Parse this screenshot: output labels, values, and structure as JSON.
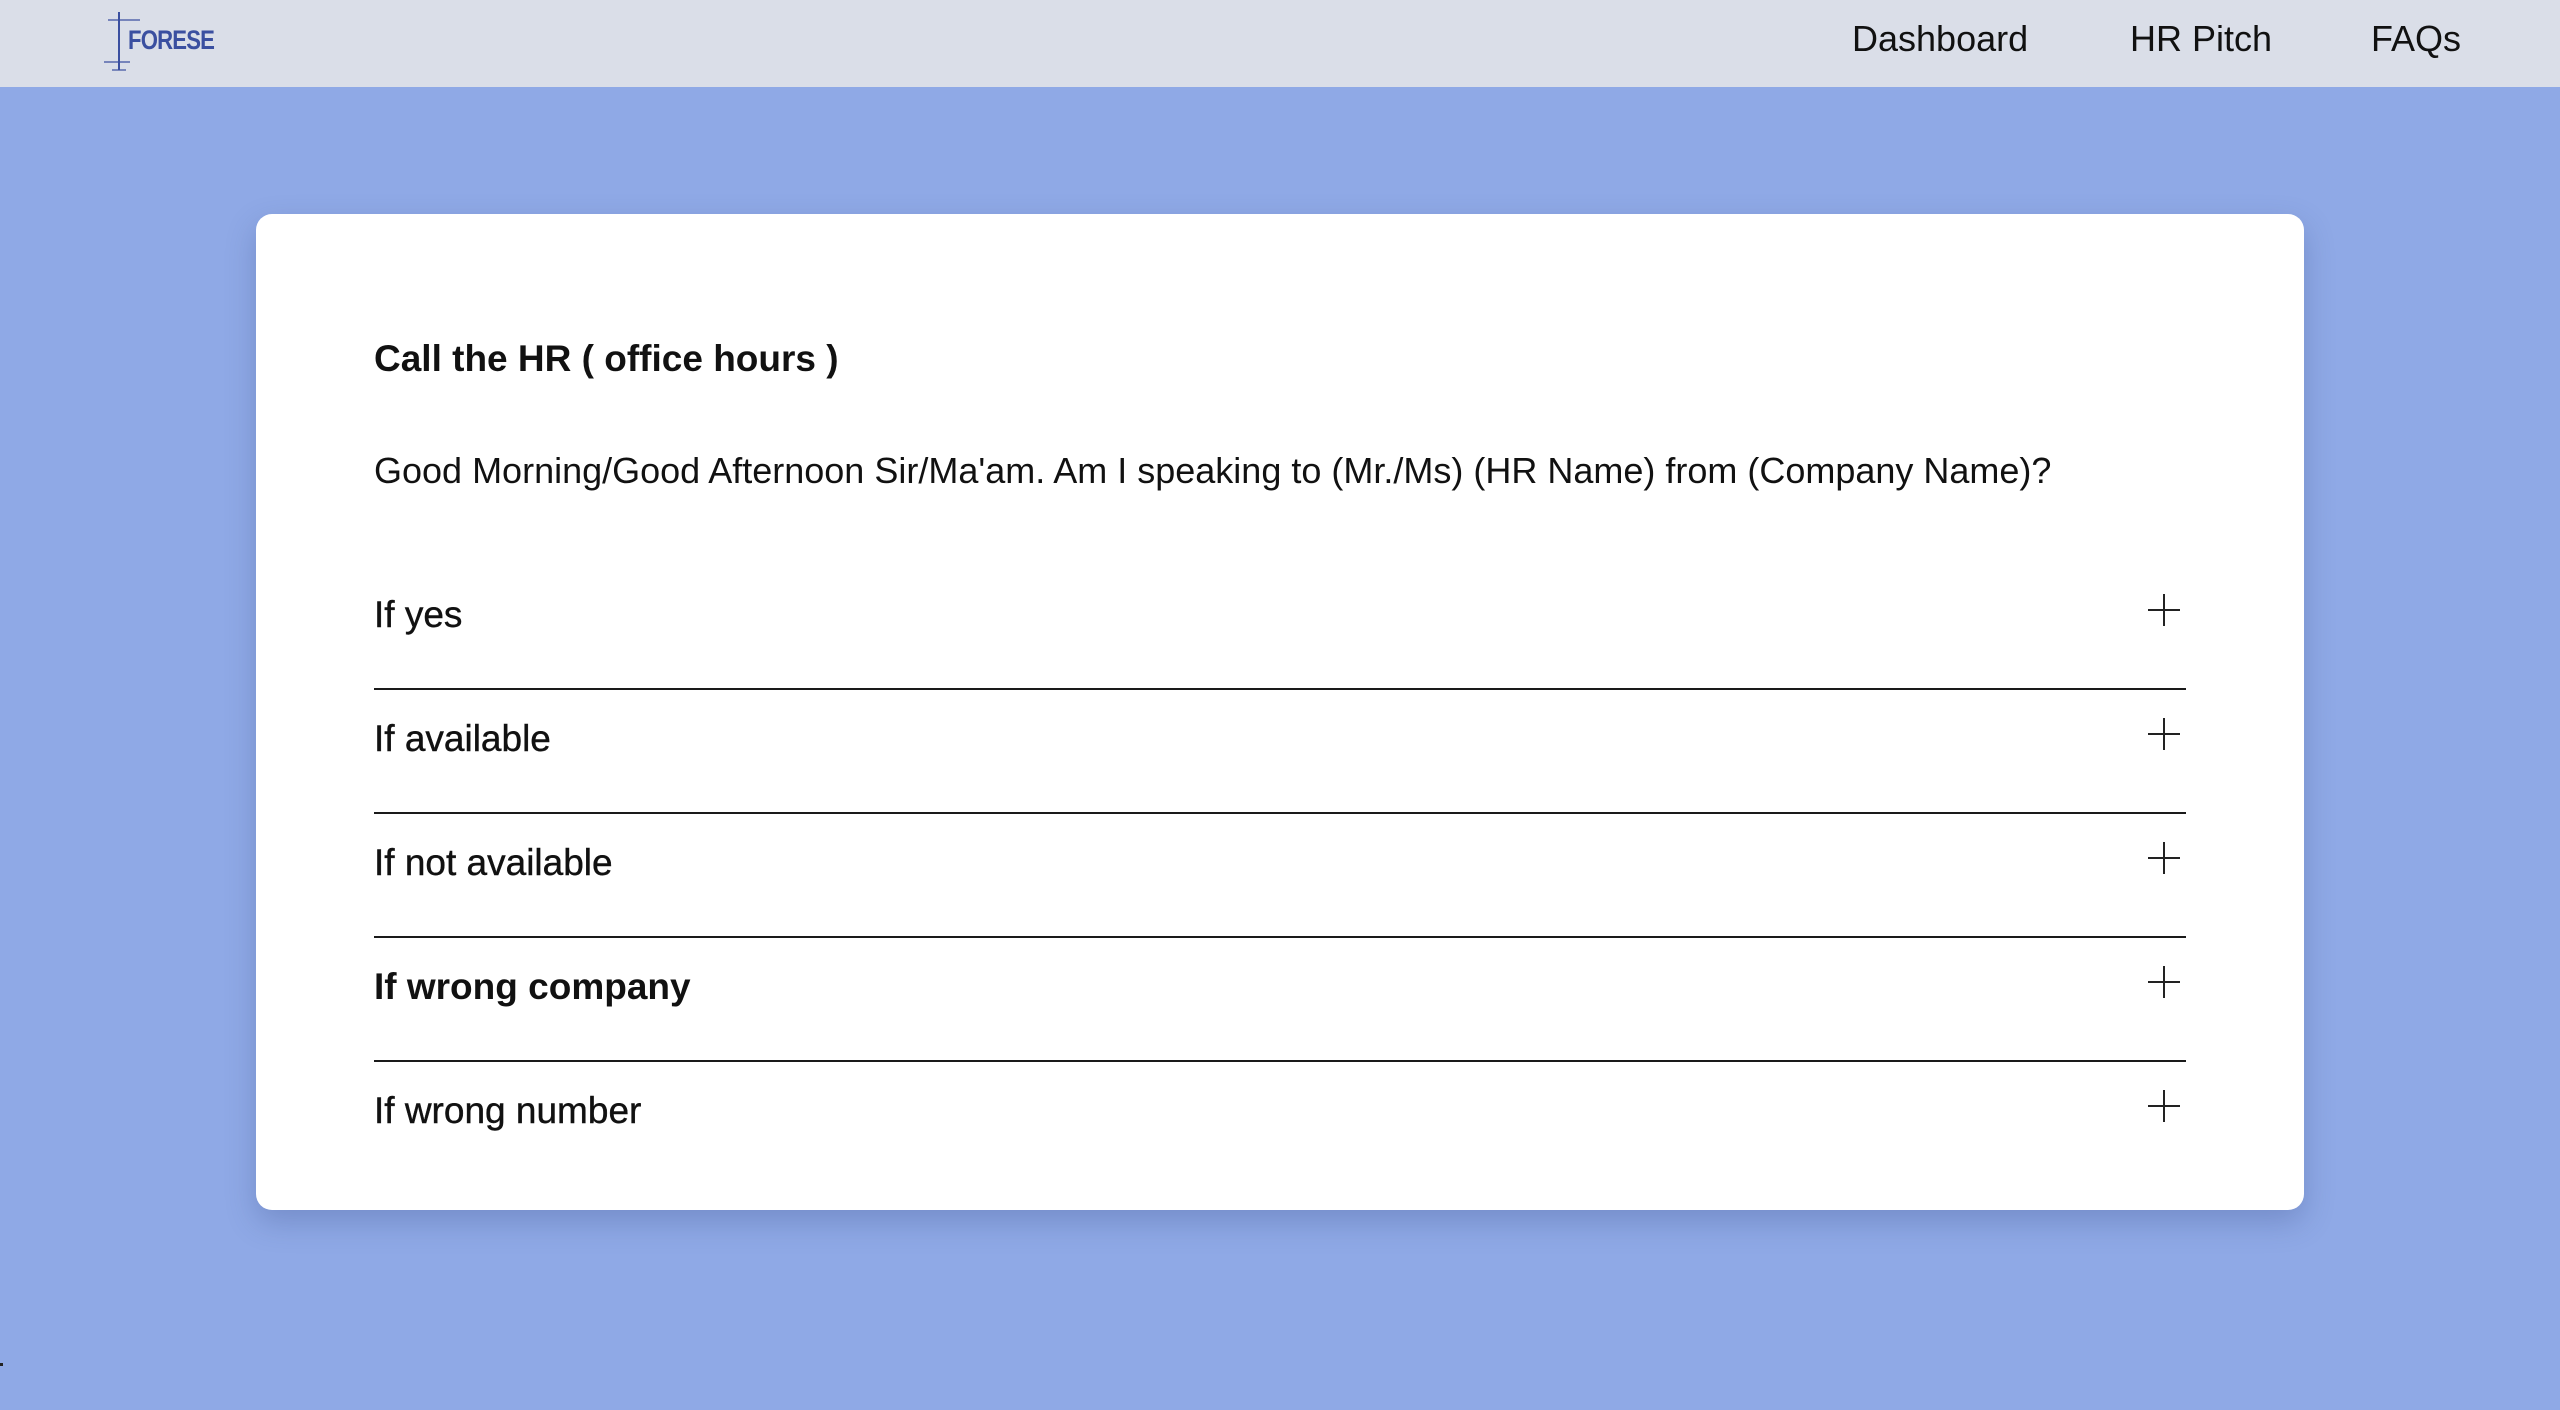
{
  "navbar": {
    "logo_text": "FORESE",
    "links": [
      {
        "label": "Dashboard"
      },
      {
        "label": "HR Pitch"
      },
      {
        "label": "FAQs"
      }
    ]
  },
  "card": {
    "title": "Call the HR ( office hours )",
    "greeting": "Good Morning/Good Afternoon Sir/Ma'am. Am I speaking to (Mr./Ms) (HR Name) from (Company Name)?",
    "accordion": [
      {
        "label": "If yes",
        "icon": "plus-icon"
      },
      {
        "label": "If available",
        "icon": "plus-icon"
      },
      {
        "label": "If not available",
        "icon": "plus-icon"
      },
      {
        "label": "If wrong company",
        "icon": "plus-icon"
      },
      {
        "label": "If wrong number",
        "icon": "plus-icon"
      }
    ]
  },
  "colors": {
    "page_background": "#8fa9e6",
    "navbar_background": "#dadee8",
    "card_background": "#ffffff",
    "logo_color": "#3a4fa0"
  }
}
